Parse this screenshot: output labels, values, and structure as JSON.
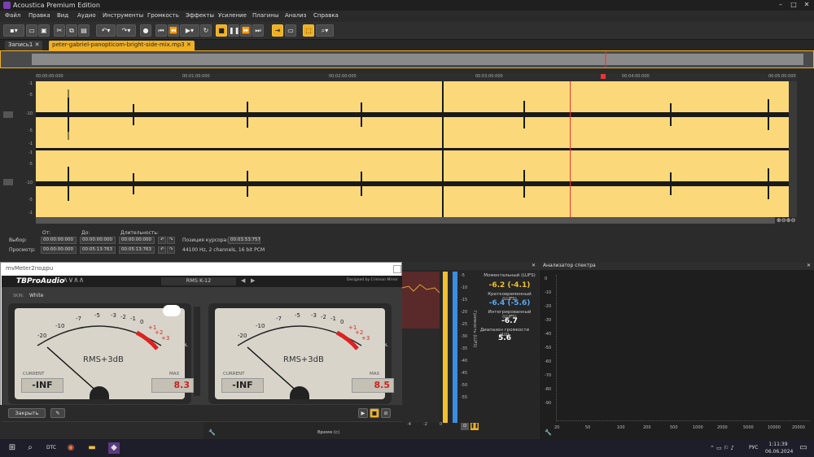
{
  "app": {
    "title": "Acoustica Premium Edition"
  },
  "window": {
    "minimize": "–",
    "maximize": "□",
    "close": "✕"
  },
  "menu": [
    "Файл",
    "Правка",
    "Вид",
    "Аудио",
    "Инструменты",
    "Громкость",
    "Эффекты",
    "Усиление",
    "Плагины",
    "Анализ",
    "Справка"
  ],
  "tabs": [
    {
      "label": "Запись1"
    },
    {
      "label": "peter-gabriel-panopticom-bright-side-mix.mp3"
    }
  ],
  "ruler": [
    "00:00:00:000",
    "00:01:00:000",
    "00:02:00:000",
    "00:03:00:000",
    "00:04:00:000",
    "00:05:00:000"
  ],
  "db_scale": [
    "-1",
    "-5",
    "-10",
    "-5",
    "-1",
    "-1",
    "-5",
    "-10",
    "-5",
    "-1"
  ],
  "time": {
    "start_label": "От:",
    "end_label": "До:",
    "length_label": "Длительность:",
    "selection_label": "Выбор:",
    "view_label": "Просмотр:",
    "sel_start": "00:00:00:000",
    "sel_end": "00:00:00:000",
    "sel_len": "00:00:00:000",
    "view_start": "00:00:00:000",
    "view_end": "00:05:13:763",
    "view_len": "00:05:13:763",
    "cursor_label": "Позиция курсора:",
    "cursor": "00:03:53:757",
    "format": "44100 Hz, 2 channels, 16 bit PCM"
  },
  "plugin": {
    "window_title": "mvMeter2пoдpu",
    "brand": "TBProAudio",
    "mode": "RMS K-12",
    "designer": "Designed by Crimson Mirror",
    "skin_label": "SKIN:",
    "skin": "White",
    "left": {
      "scale_label": "RMS+3dB",
      "current_label": "CURRENT",
      "current": "-INF",
      "max_label": "MAX",
      "max": "8.3",
      "ol": "OL"
    },
    "right": {
      "scale_label": "RMS+3dB",
      "current_label": "CURRENT",
      "current": "-INF",
      "max_label": "MAX",
      "max": "8.5",
      "ol": "OL"
    },
    "scale": [
      "-20",
      "-10",
      "-7",
      "-5",
      "-3",
      "-2",
      "-1",
      "0",
      "+1",
      "+2",
      "+3"
    ],
    "close_btn": "Закрыть",
    "dashes": "-----------"
  },
  "loudness": {
    "momentary_label": "Моментальный (LUFS)",
    "momentary": "-6.2 (-4.1)",
    "short_label": "Кратковременный (LUFS)",
    "short": "-6.4 (-5.6)",
    "integrated_label": "Интегрированный (LUFS)",
    "integrated": "-6.7",
    "range_label": "Диапазон громкости (LU)",
    "range": "5.6",
    "axis_label": "Громкость (LUFS)",
    "time_label": "Время (с)",
    "scale": [
      "-5",
      "-10",
      "-15",
      "-20",
      "-25",
      "-30",
      "-35",
      "-40",
      "-45",
      "-50",
      "-55"
    ],
    "xticks": [
      "-4",
      "-2",
      "0"
    ]
  },
  "spectrum": {
    "title": "Анализатор спектра",
    "yticks": [
      "0",
      "-10",
      "-20",
      "-30",
      "-40",
      "-50",
      "-60",
      "-70",
      "-80",
      "-90"
    ],
    "xticks": [
      "20",
      "50",
      "100",
      "200",
      "500",
      "1000",
      "2000",
      "5000",
      "10000",
      "20000"
    ]
  },
  "taskbar": {
    "time": "1:11:39",
    "date": "06.06.2024",
    "lang": "РУС",
    "start_icon": "windows-icon",
    "search_icon": "search-icon",
    "app_label": "DTC"
  }
}
